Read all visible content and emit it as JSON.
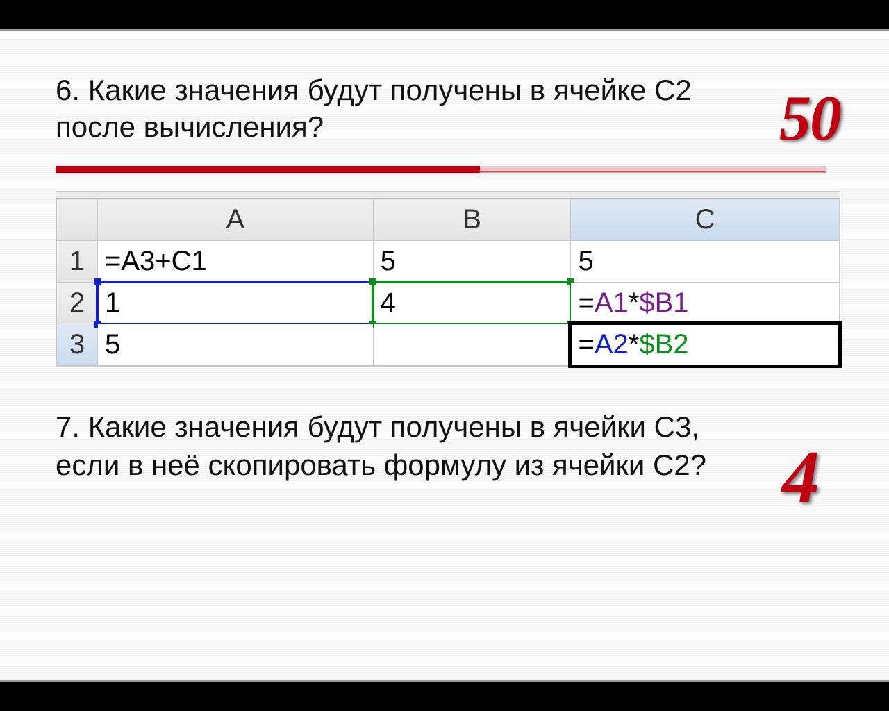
{
  "q6": {
    "text": "6. Какие значения будут получены в ячейке С2 после вычисления?",
    "answer": "50"
  },
  "q7": {
    "text": "7. Какие значения будут получены в ячейки С3, если в неё скопировать формулу из ячейки С2?",
    "answer": "4"
  },
  "spreadsheet": {
    "columns": [
      "A",
      "B",
      "C"
    ],
    "rows": [
      "1",
      "2",
      "3"
    ],
    "cells": {
      "A1": "=A3+C1",
      "B1": "5",
      "C1": "5",
      "A2": "1",
      "B2": "4",
      "C2": "=A1*$B1",
      "A3": "5",
      "B3": "",
      "C3": "=A2*$B2"
    },
    "c2_parts": {
      "ref1": "A1",
      "op": "*",
      "ref2": "$B1"
    },
    "c3_parts": {
      "ref1": "A2",
      "op": "*",
      "ref2": "$B2"
    },
    "formula_prefix": "="
  }
}
